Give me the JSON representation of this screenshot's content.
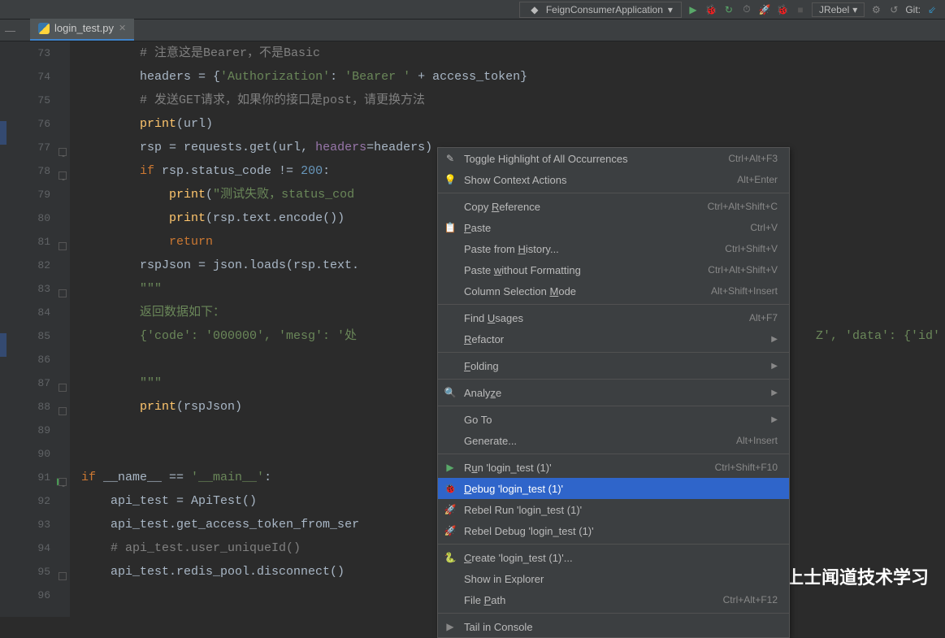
{
  "toolbar": {
    "run_config": "FeignConsumerApplication",
    "jrebel": "JRebel",
    "git": "Git:"
  },
  "tab": {
    "filename": "login_test.py"
  },
  "lines": {
    "start": 73,
    "count": 24
  },
  "code": {
    "l73": "# 注意这是Bearer，不是Basic",
    "l74a": "headers = ",
    "l74b": "{",
    "l74c": "'Authorization'",
    "l74d": ": ",
    "l74e": "'Bearer '",
    "l74f": " + access_token",
    "l74g": "}",
    "l75": "# 发送GET请求，如果你的接口是post，请更换方法",
    "l76a": "print",
    "l76b": "(url)",
    "l77a": "rsp = requests.get(url",
    "l77b": ", ",
    "l77c": "headers",
    "l77d": "=headers)",
    "l78a": "if ",
    "l78b": "rsp.status_code != ",
    "l78c": "200",
    "l78d": ":",
    "l79a": "print",
    "l79b": "(",
    "l79c": "\"测试失败，status_cod",
    "l80a": "print",
    "l80b": "(rsp.text.encode())",
    "l81": "return",
    "l82a": "rspJson = json.loads(rsp.text.",
    "l83": "\"\"\"",
    "l84": "返回数据如下：",
    "l85a": "{'code': '000000', 'mesg': '处",
    "l85b": "Z', 'data': {'id'",
    "l87": "\"\"\"",
    "l88a": "print",
    "l88b": "(rspJson)",
    "l91a": "if ",
    "l91b": "__name__ == ",
    "l91c": "'__main__'",
    "l91d": ":",
    "l92": "api_test = ApiTest()",
    "l93": "api_test.get_access_token_from_ser",
    "l94": "# api_test.user_uniqueId()",
    "l95": "api_test.redis_pool.disconnect()"
  },
  "menu": [
    {
      "icon": "pencil",
      "label": "Toggle Highlight of All Occurrences",
      "sc": "Ctrl+Alt+F3",
      "type": "item"
    },
    {
      "icon": "bulb",
      "label": "Show Context Actions",
      "sc": "Alt+Enter",
      "type": "item"
    },
    {
      "type": "sep"
    },
    {
      "icon": "",
      "label": "Copy Reference",
      "sc": "Ctrl+Alt+Shift+C",
      "type": "item",
      "ul": "R"
    },
    {
      "icon": "paste",
      "label": "Paste",
      "sc": "Ctrl+V",
      "type": "item",
      "ul": "P"
    },
    {
      "icon": "",
      "label": "Paste from History...",
      "sc": "Ctrl+Shift+V",
      "type": "item",
      "ul": "H"
    },
    {
      "icon": "",
      "label": "Paste without Formatting",
      "sc": "Ctrl+Alt+Shift+V",
      "type": "item",
      "ul": "w"
    },
    {
      "icon": "",
      "label": "Column Selection Mode",
      "sc": "Alt+Shift+Insert",
      "type": "item",
      "ul": "M"
    },
    {
      "type": "sep"
    },
    {
      "icon": "",
      "label": "Find Usages",
      "sc": "Alt+F7",
      "type": "item",
      "ul": "U"
    },
    {
      "icon": "",
      "label": "Refactor",
      "sc": "",
      "type": "sub",
      "ul": "R"
    },
    {
      "type": "sep"
    },
    {
      "icon": "",
      "label": "Folding",
      "sc": "",
      "type": "sub",
      "ul": "F"
    },
    {
      "type": "sep"
    },
    {
      "icon": "analyze",
      "label": "Analyze",
      "sc": "",
      "type": "sub",
      "ul": "z"
    },
    {
      "type": "sep"
    },
    {
      "icon": "",
      "label": "Go To",
      "sc": "",
      "type": "sub"
    },
    {
      "icon": "",
      "label": "Generate...",
      "sc": "Alt+Insert",
      "type": "item"
    },
    {
      "type": "sep"
    },
    {
      "icon": "run",
      "label": "Run 'login_test (1)'",
      "sc": "Ctrl+Shift+F10",
      "type": "item",
      "ul": "u"
    },
    {
      "icon": "debug",
      "label": "Debug 'login_test (1)'",
      "sc": "",
      "type": "item",
      "sel": true,
      "ul": "D"
    },
    {
      "icon": "rebel",
      "label": "Rebel Run 'login_test (1)'",
      "sc": "",
      "type": "item"
    },
    {
      "icon": "rebeld",
      "label": "Rebel Debug 'login_test (1)'",
      "sc": "",
      "type": "item"
    },
    {
      "type": "sep"
    },
    {
      "icon": "py",
      "label": "Create 'login_test (1)'...",
      "sc": "",
      "type": "item",
      "ul": "C"
    },
    {
      "icon": "",
      "label": "Show in Explorer",
      "sc": "",
      "type": "item"
    },
    {
      "icon": "",
      "label": "File Path",
      "sc": "Ctrl+Alt+F12",
      "type": "item",
      "ul": "P"
    },
    {
      "type": "sep"
    },
    {
      "icon": "tail",
      "label": "Tail in Console",
      "sc": "",
      "type": "item"
    }
  ],
  "watermark": "头条 @上士闻道技术学习"
}
